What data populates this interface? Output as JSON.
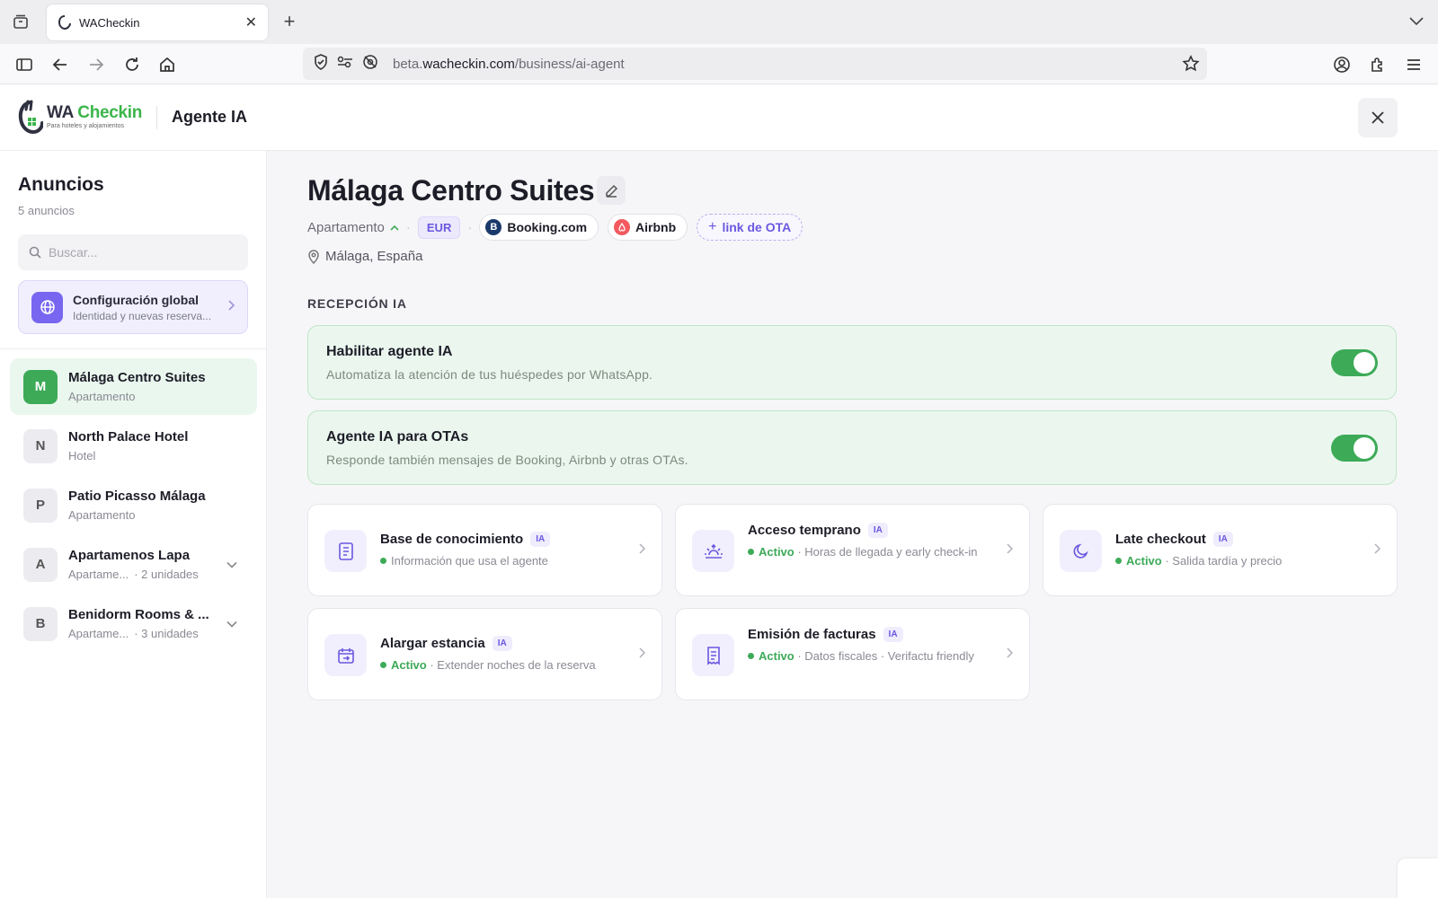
{
  "browser": {
    "tab_title": "WACheckin",
    "url_host_prefix": "beta.",
    "url_host": "wacheckin.com",
    "url_path": "/business/ai-agent"
  },
  "header": {
    "logo_wa": "WA ",
    "logo_checkin": "Checkin",
    "logo_tagline": "Para hoteles y alojamientos",
    "title": "Agente IA"
  },
  "sidebar": {
    "title": "Anuncios",
    "count": "5 anuncios",
    "search_placeholder": "Buscar...",
    "global": {
      "title": "Configuración global",
      "subtitle": "Identidad y nuevas reserva..."
    },
    "listings": [
      {
        "initial": "M",
        "name": "Málaga Centro Suites",
        "type": "Apartamento",
        "units": ""
      },
      {
        "initial": "N",
        "name": "North Palace Hotel",
        "type": "Hotel",
        "units": ""
      },
      {
        "initial": "P",
        "name": "Patio Picasso Málaga",
        "type": "Apartamento",
        "units": ""
      },
      {
        "initial": "A",
        "name": "Apartamenos Lapa",
        "type": "Apartame...",
        "units": "· 2 unidades"
      },
      {
        "initial": "B",
        "name": "Benidorm Rooms & ...",
        "type": "Apartame...",
        "units": "· 3 unidades"
      }
    ]
  },
  "main": {
    "title": "Málaga Centro Suites",
    "type": "Apartamento",
    "currency": "EUR",
    "ota_booking": "Booking.com",
    "ota_airbnb": "Airbnb",
    "add_ota": "link de OTA",
    "location": "Málaga, España",
    "section_label": "RECEPCIÓN IA",
    "toggles": [
      {
        "title": "Habilitar agente IA",
        "subtitle": "Automatiza la atención de tus huéspedes por WhatsApp.",
        "on": true
      },
      {
        "title": "Agente IA para OTAs",
        "subtitle": "Responde también mensajes de Booking, Airbnb y otras OTAs.",
        "on": true
      }
    ],
    "ia_badge": "IA",
    "features": [
      {
        "title": "Base de conocimiento",
        "status": "",
        "desc": "Información que usa el agente",
        "icon": "book-icon"
      },
      {
        "title": "Acceso temprano",
        "status": "Activo",
        "desc": " · Horas de llegada y early check-in",
        "icon": "sunrise-icon"
      },
      {
        "title": "Late checkout",
        "status": "Activo",
        "desc": " · Salida tardía y precio",
        "icon": "moon-icon"
      },
      {
        "title": "Alargar estancia",
        "status": "Activo",
        "desc": " · Extender noches de la reserva",
        "icon": "calendar-icon"
      },
      {
        "title": "Emisión de facturas",
        "status": "Activo",
        "desc": " · Datos fiscales · Verifactu friendly",
        "icon": "receipt-icon"
      }
    ]
  },
  "colors": {
    "accent_green": "#3daa58",
    "accent_purple": "#6a58e0"
  }
}
